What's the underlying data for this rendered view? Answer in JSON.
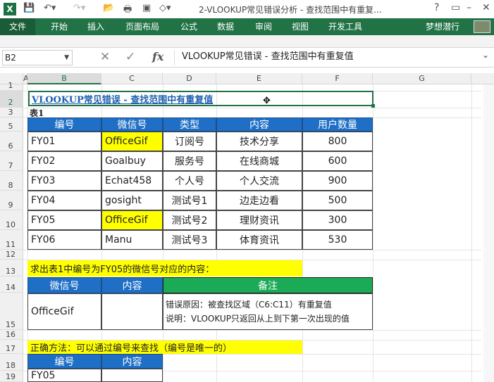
{
  "titlebar": {
    "title": "2-VLOOKUP常见错误分析 - 查找范围中有重复..."
  },
  "ribbon": {
    "file": "文件",
    "tabs": [
      "开始",
      "插入",
      "页面布局",
      "公式",
      "数据",
      "审阅",
      "视图",
      "开发工具"
    ],
    "user": "梦想潜行"
  },
  "formula_bar": {
    "name_box": "B2",
    "cancel": "✕",
    "enter": "✓",
    "fx": "fx",
    "value": "VLOOKUP常见错误 - 查找范围中有重复值"
  },
  "columns": [
    "A",
    "B",
    "C",
    "D",
    "E",
    "F",
    "G"
  ],
  "rows": [
    "1",
    "2",
    "3",
    "5",
    "6",
    "7",
    "8",
    "9",
    "10",
    "11",
    "12",
    "13",
    "14",
    "15",
    "16",
    "17",
    "18",
    "19"
  ],
  "sheet": {
    "b2": "VLOOKUP常见错误 - 查找范围中有重复值",
    "b3": "表1",
    "t1_headers": [
      "编号",
      "微信号",
      "类型",
      "内容",
      "用户数量"
    ],
    "t1_rows": [
      [
        "FY01",
        "OfficeGif",
        "订阅号",
        "技术分享",
        "800"
      ],
      [
        "FY02",
        "Goalbuy",
        "服务号",
        "在线商城",
        "600"
      ],
      [
        "FY03",
        "Echat458",
        "个人号",
        "个人交流",
        "900"
      ],
      [
        "FY04",
        "gosight",
        "测试号1",
        "边走边看",
        "500"
      ],
      [
        "FY05",
        "OfficeGif",
        "测试号2",
        "理财资讯",
        "300"
      ],
      [
        "FY06",
        "Manu",
        "测试号3",
        "体育资讯",
        "530"
      ]
    ],
    "b13": "求出表1中编号为FY05的微信号对应的内容：",
    "t2_headers": [
      "微信号",
      "内容",
      "备注"
    ],
    "t2_row": {
      "wx": "OfficeGif",
      "content": "",
      "note1": "错误原因：被查找区域（C6:C11）有重复值",
      "note2": "说明：VLOOKUP只返回从上到下第一次出现的值"
    },
    "b17": "正确方法：可以通过编号来查找（编号是唯一的）",
    "t3_headers": [
      "编号",
      "内容"
    ],
    "t3_row": [
      "FY05",
      ""
    ]
  },
  "colors": {
    "accent": "#217346",
    "header_blue": "#1f6fc6",
    "header_green": "#1bab57",
    "highlight": "#ffff00"
  }
}
